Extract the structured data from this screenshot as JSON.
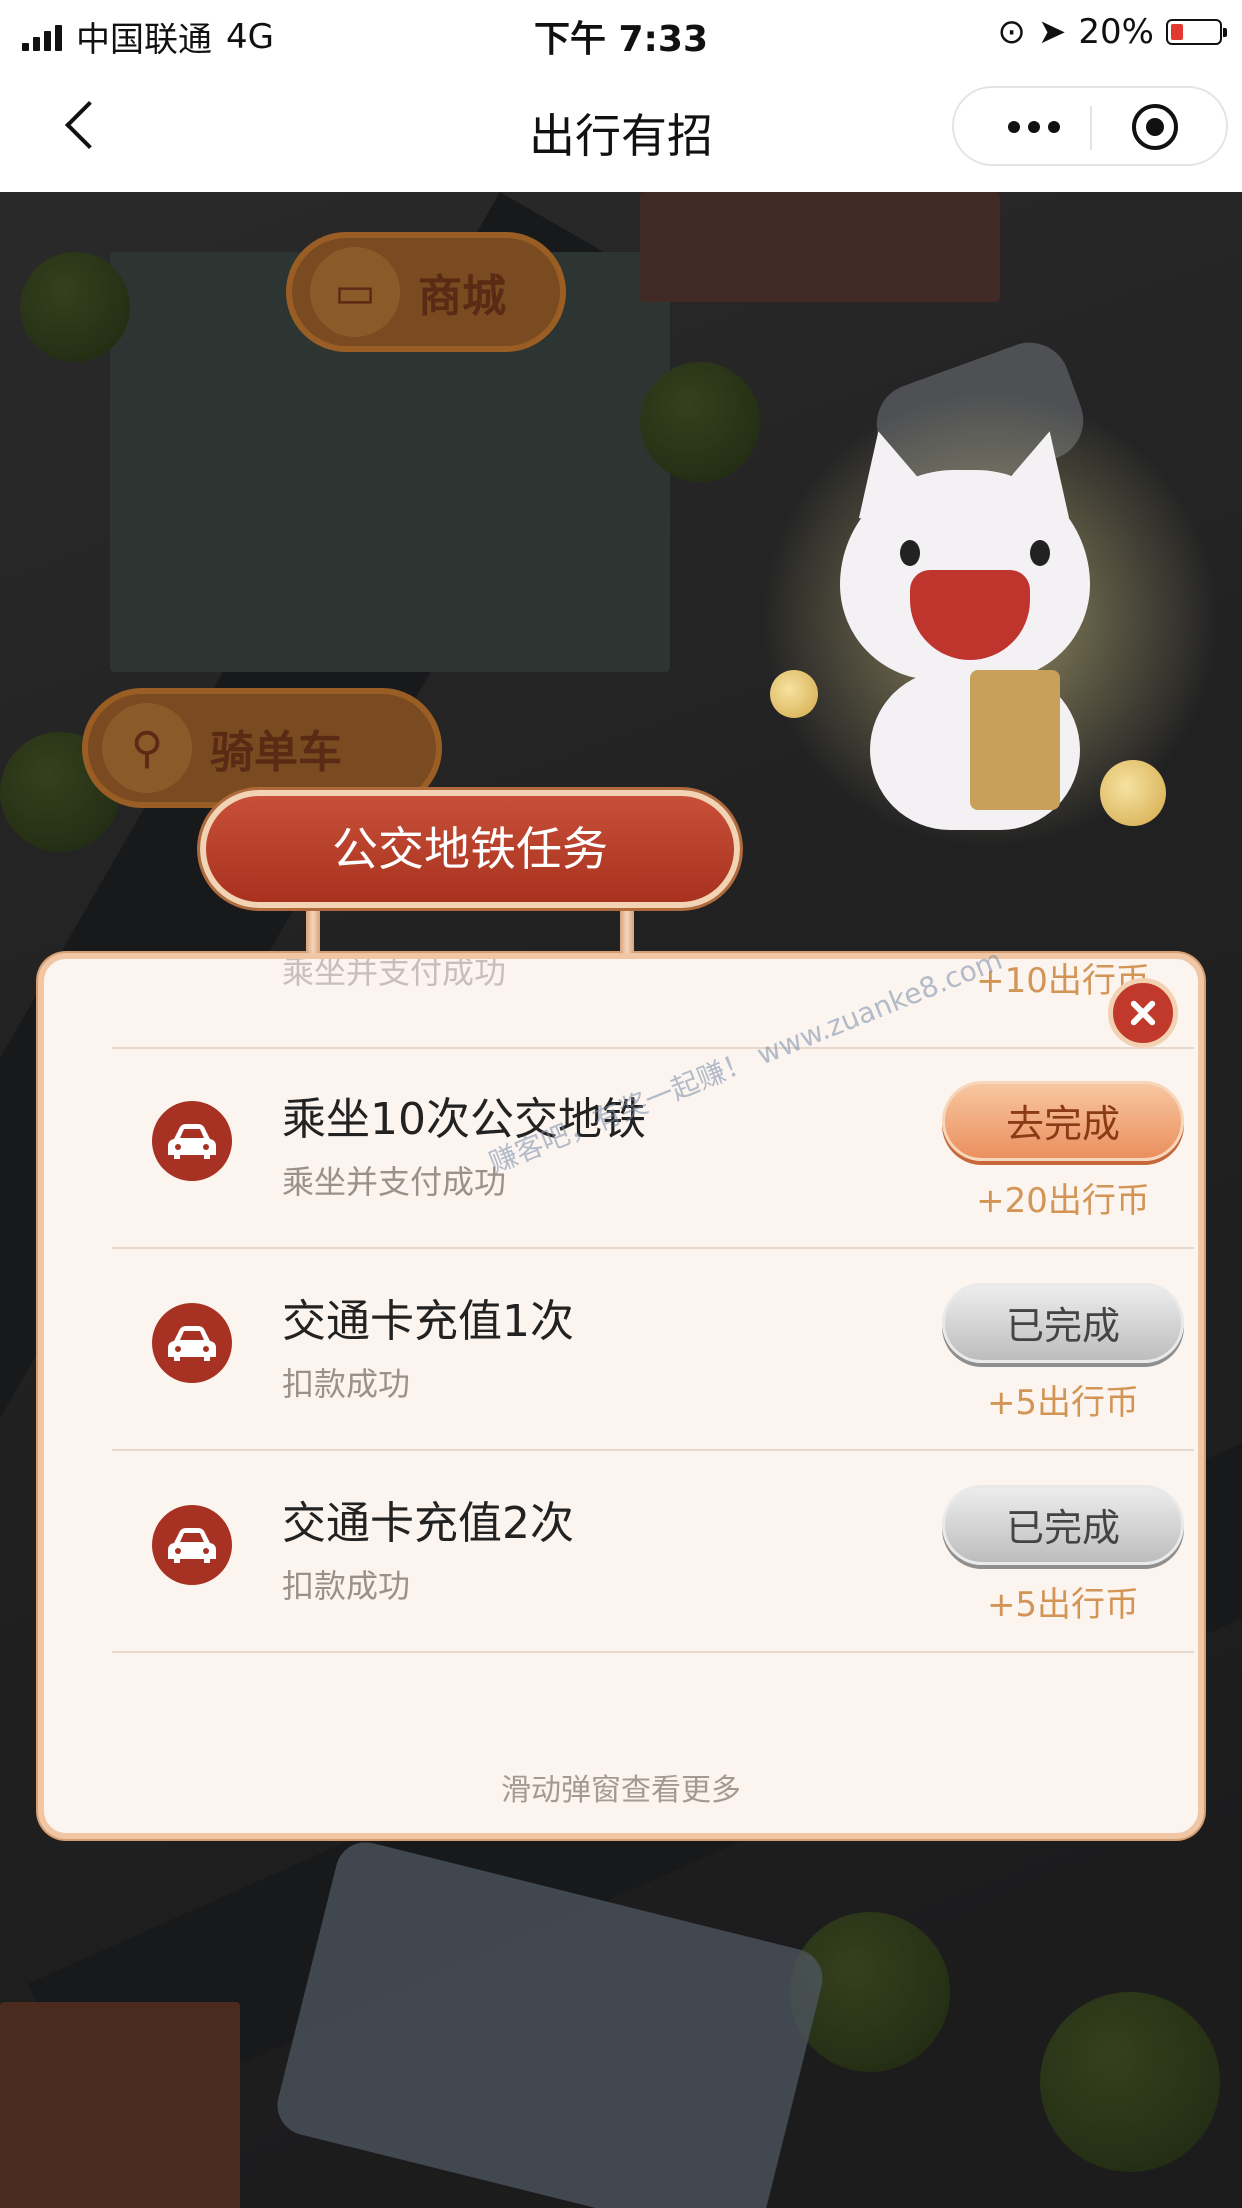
{
  "status_bar": {
    "carrier": "中国联通",
    "network": "4G",
    "time": "下午 7:33",
    "battery": "20%"
  },
  "nav": {
    "title": "出行有招"
  },
  "scene": {
    "mall_label": "商城",
    "bike_label": "骑单车"
  },
  "panel": {
    "title": "公交地铁任务",
    "partial_row": {
      "subtitle": "乘坐并支付成功",
      "reward": "+10出行币"
    },
    "rows": [
      {
        "title": "乘坐10次公交地铁",
        "subtitle": "乘坐并支付成功",
        "button": "去完成",
        "reward": "+20出行币",
        "state": "todo"
      },
      {
        "title": "交通卡充值1次",
        "subtitle": "扣款成功",
        "button": "已完成",
        "reward": "+5出行币",
        "state": "done"
      },
      {
        "title": "交通卡充值2次",
        "subtitle": "扣款成功",
        "button": "已完成",
        "reward": "+5出行币",
        "state": "done"
      }
    ],
    "hint": "滑动弹窗查看更多"
  },
  "watermark": "赚客吧，有奖一起赚！ www.zuanke8.com",
  "colors": {
    "accent_red": "#a73224",
    "todo_button": "#eb8f5e",
    "reward_gold": "#d29556",
    "panel_bg": "#fbf4ef"
  },
  "icons": [
    "back-icon",
    "more-icon",
    "capsule-close-icon",
    "car-icon",
    "close-icon",
    "shopping-bag-icon",
    "bicycle-icon"
  ]
}
